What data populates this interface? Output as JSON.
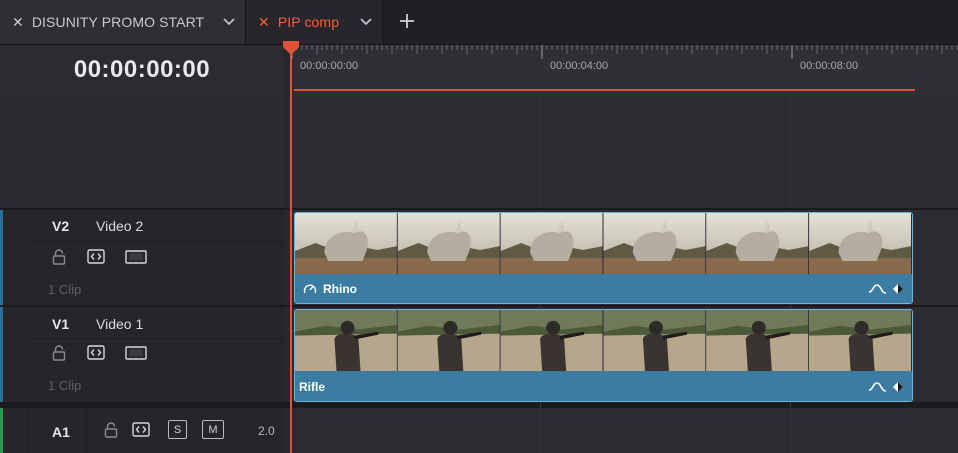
{
  "tabs": [
    {
      "label": "DISUNITY PROMO START",
      "active": false
    },
    {
      "label": "PIP comp",
      "active": true,
      "color": "#ff5c3a"
    }
  ],
  "timecode": "00:00:00:00",
  "ruler": {
    "labels": [
      "00:00:00:00",
      "00:00:04:00",
      "00:00:08:00"
    ]
  },
  "tracks": {
    "v2": {
      "id": "V2",
      "name": "Video 2",
      "clip_count": "1 Clip"
    },
    "v1": {
      "id": "V1",
      "name": "Video 1",
      "clip_count": "1 Clip"
    },
    "a1": {
      "id": "A1",
      "level": "2.0",
      "solo_label": "S",
      "mute_label": "M"
    }
  },
  "clips": {
    "rhino": {
      "name": "Rhino"
    },
    "rifle": {
      "name": "Rifle"
    }
  },
  "icons": {
    "close": "close-icon",
    "chevron": "chevron-down-icon",
    "add": "plus-icon",
    "lock": "lock-icon",
    "auto_select": "auto-select-icon",
    "track_output": "track-output-icon",
    "speed": "speed-change-icon",
    "curve": "curve-icon",
    "keyframe": "keyframe-icon"
  },
  "colors": {
    "accent": "#e0523a",
    "clip": "#3b7ca3",
    "video_track_indicator": "#2e6e99",
    "audio_track_indicator": "#2f9a4f"
  }
}
